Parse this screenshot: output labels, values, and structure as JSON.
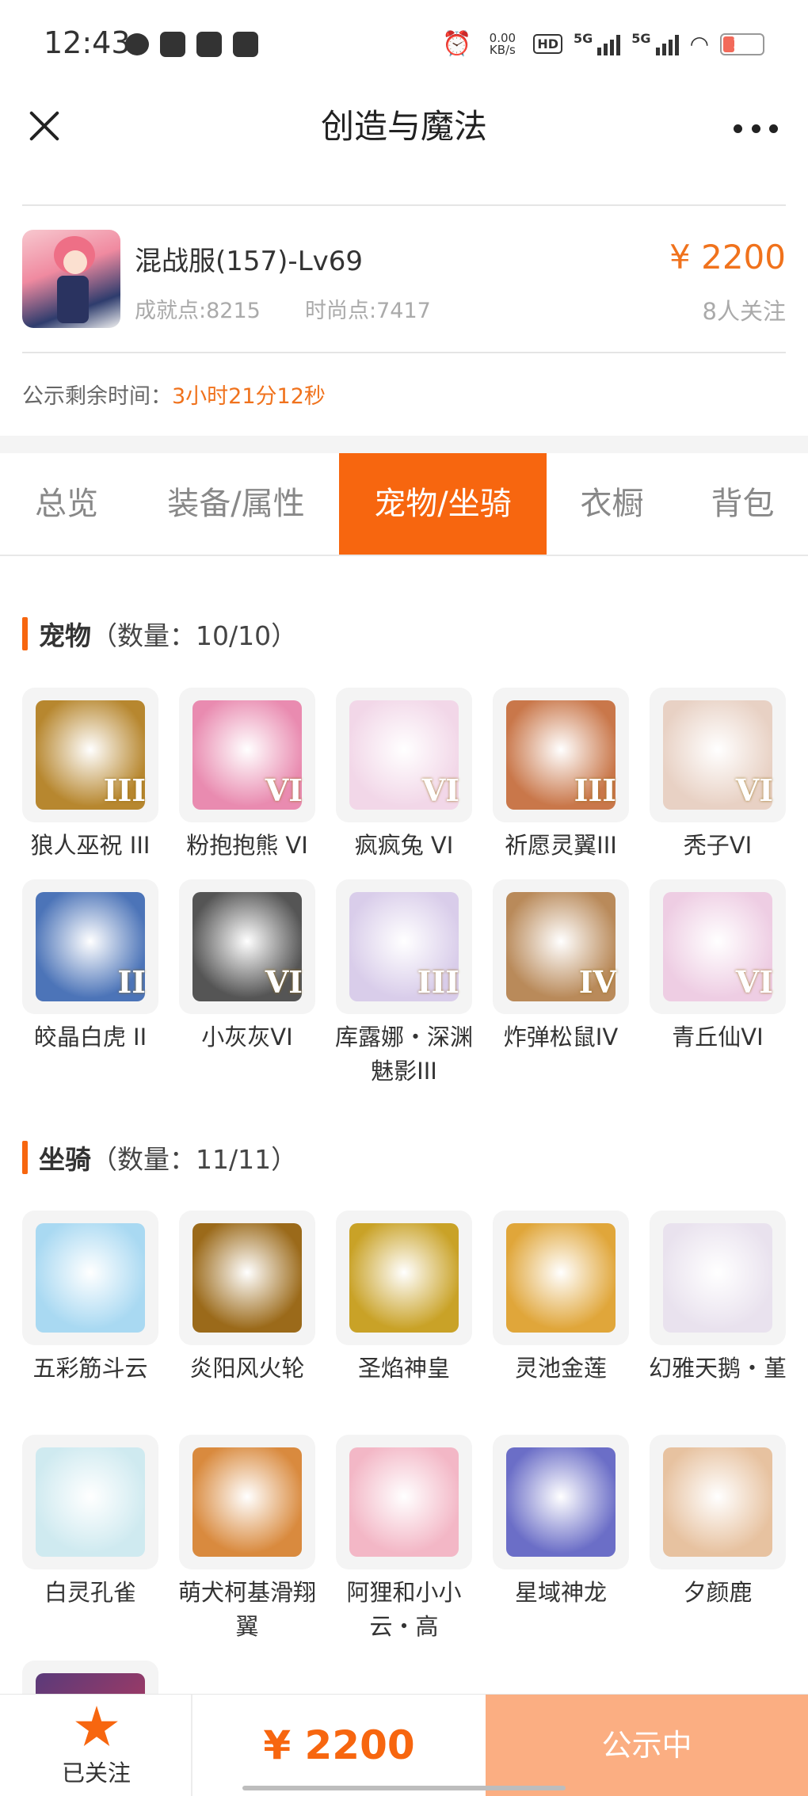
{
  "status_bar": {
    "time": "12:43",
    "net_speed": "0.00 KB/s",
    "hd_label": "HD",
    "signal_label_1": "5G",
    "signal_label_2": "5G",
    "battery": "14"
  },
  "header": {
    "title": "创造与魔法"
  },
  "account": {
    "name": "混战服(157)-Lv69",
    "achievement": "成就点:8215",
    "fashion": "时尚点:7417",
    "price": "¥ 2200",
    "followers": "8人关注",
    "remaining_label": "公示剩余时间：",
    "remaining_value": "3小时21分12秒"
  },
  "tabs": [
    {
      "label": "总览",
      "active": false
    },
    {
      "label": "装备/属性",
      "active": false
    },
    {
      "label": "宠物/坐骑",
      "active": true
    },
    {
      "label": "衣橱",
      "active": false
    },
    {
      "label": "背包",
      "active": false
    }
  ],
  "pets": {
    "title": "宠物",
    "count": "（数量：10/10）",
    "items": [
      {
        "label": "狼人巫祝 III",
        "rank": "III",
        "color": "#b7872f"
      },
      {
        "label": "粉抱抱熊 VI",
        "rank": "VI",
        "color": "#e98bb0"
      },
      {
        "label": "疯疯兔 VI",
        "rank": "VI",
        "color": "#f2d7e8"
      },
      {
        "label": "祈愿灵翼III",
        "rank": "III",
        "color": "#c9774a"
      },
      {
        "label": "秃子VI",
        "rank": "VI",
        "color": "#e8d1c4"
      },
      {
        "label": "皎晶白虎 II",
        "rank": "II",
        "color": "#4c74b8"
      },
      {
        "label": "小灰灰VI",
        "rank": "VI",
        "color": "#555555"
      },
      {
        "label": "库露娜・深渊魅影III",
        "rank": "III",
        "color": "#d9cdea"
      },
      {
        "label": "炸弹松鼠IV",
        "rank": "IV",
        "color": "#b98a5a"
      },
      {
        "label": "青丘仙VI",
        "rank": "VI",
        "color": "#eecde3"
      }
    ]
  },
  "mounts": {
    "title": "坐骑",
    "count": "（数量：11/11）",
    "items": [
      {
        "label": "五彩筋斗云",
        "color": "#a9d9f2"
      },
      {
        "label": "炎阳风火轮",
        "color": "#9b6a1a"
      },
      {
        "label": "圣焰神皇",
        "color": "#c9a227"
      },
      {
        "label": "灵池金莲",
        "color": "#e0a63a"
      },
      {
        "label": "幻雅天鹅・堇",
        "color": "#e9e2ee"
      },
      {
        "label": "白灵孔雀",
        "color": "#cfeaf0"
      },
      {
        "label": "萌犬柯基滑翔翼",
        "color": "#d98a3e"
      },
      {
        "label": "阿狸和小小云・高",
        "color": "#f3b7c6"
      },
      {
        "label": "星域神龙",
        "color": "#6b6ec7"
      },
      {
        "label": "夕颜鹿",
        "color": "#e7c2a0"
      }
    ]
  },
  "bottom_bar": {
    "follow_label": "已关注",
    "price": "¥ 2200",
    "status_label": "公示中"
  },
  "colors": {
    "accent": "#f7660f",
    "price": "#f0721c",
    "status_button": "#fbae82"
  }
}
